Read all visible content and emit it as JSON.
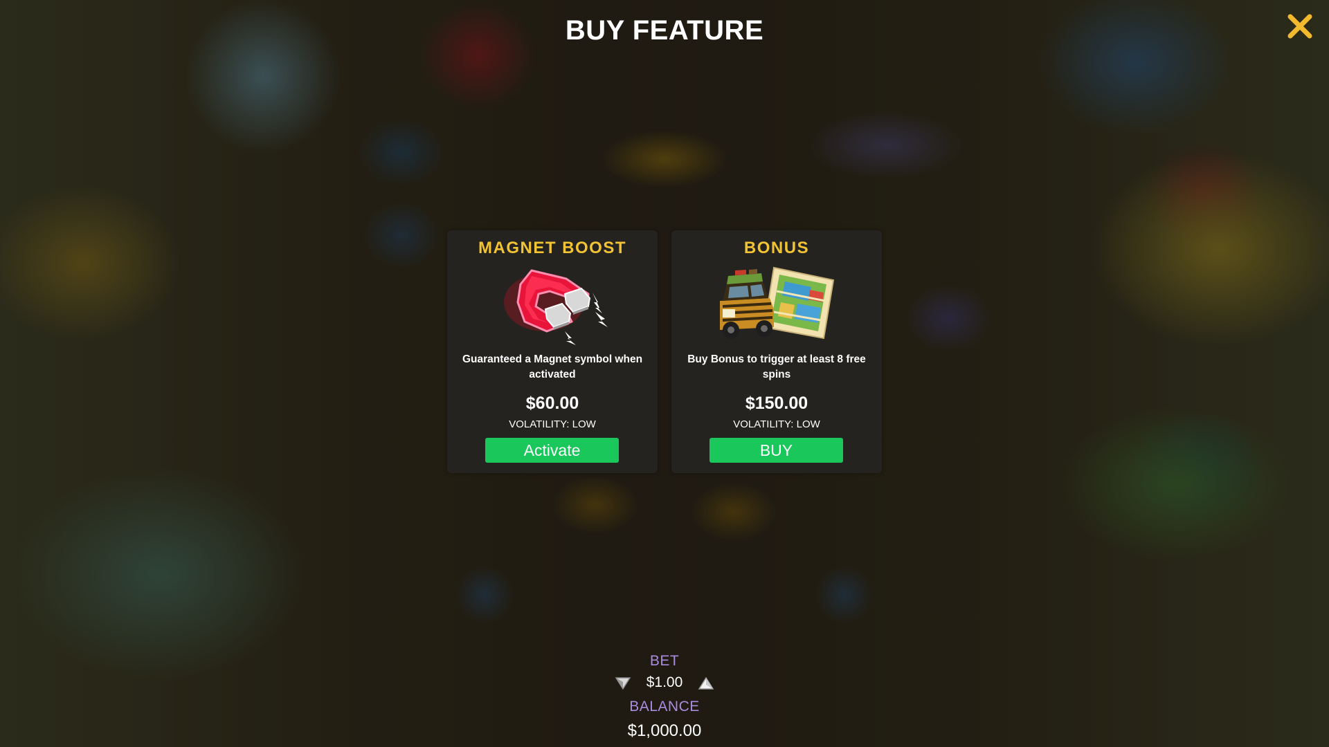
{
  "title": "BUY FEATURE",
  "close": {
    "icon": "close-icon",
    "color": "#f2b82e"
  },
  "cards": [
    {
      "title": "MAGNET BOOST",
      "image": "magnet-icon",
      "description": "Guaranteed a Magnet symbol when activated",
      "price": "$60.00",
      "volatility": "VOLATILITY: LOW",
      "button_label": "Activate"
    },
    {
      "title": "BONUS",
      "image": "safari-jeep-map-icon",
      "description": "Buy Bonus to trigger at least 8 free spins",
      "price": "$150.00",
      "volatility": "VOLATILITY: LOW",
      "button_label": "BUY"
    }
  ],
  "bet": {
    "label": "BET",
    "value": "$1.00",
    "decrease_icon": "triangle-down-icon",
    "increase_icon": "triangle-up-icon"
  },
  "balance": {
    "label": "BALANCE",
    "value": "$1,000.00"
  },
  "colors": {
    "title_gold": "#f2c433",
    "button_green": "#19c75a",
    "label_purple": "#a98ce0",
    "card_bg": "#262421"
  }
}
